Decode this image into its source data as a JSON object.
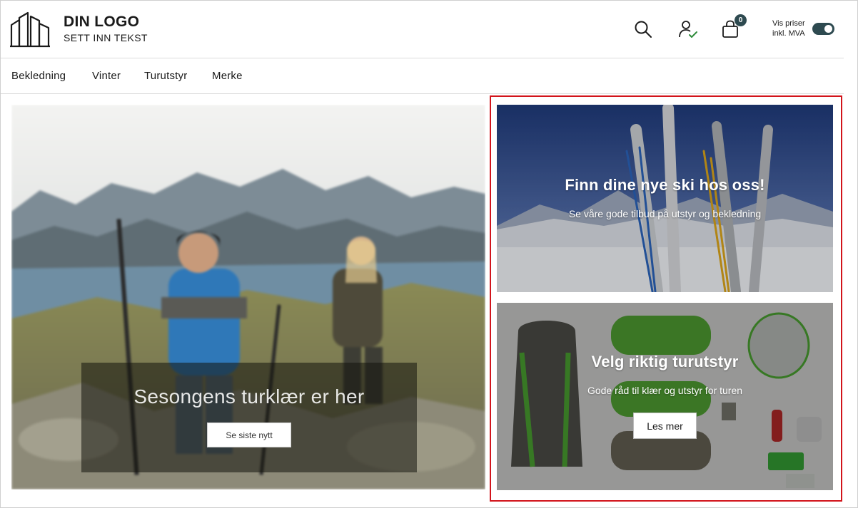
{
  "brand": {
    "title": "DIN LOGO",
    "subtitle": "SETT INN TEKST",
    "logo_icon": "buildings-outline-logo"
  },
  "header": {
    "icons": [
      "search-icon",
      "user-check-icon",
      "shopping-bag-icon"
    ],
    "cart_count": "0",
    "vat_line1": "Vis priser",
    "vat_line2": "inkl. MVA",
    "vat_toggle_on": true,
    "accent_color": "#2e4a50"
  },
  "nav": {
    "items": [
      {
        "label": "Bekledning"
      },
      {
        "label": "Vinter"
      },
      {
        "label": "Turutstyr"
      },
      {
        "label": "Merke"
      }
    ]
  },
  "hero": {
    "title": "Sesongens turklær er her",
    "button_label": "Se siste nytt"
  },
  "cards": [
    {
      "title": "Finn dine nye ski hos oss!",
      "subtitle": "Se våre gode tilbud på utstyr og bekledning"
    },
    {
      "title": "Velg riktig turutstyr",
      "subtitle": "Gode råd til klær og utstyr for turen",
      "button_label": "Les mer"
    }
  ],
  "highlight_color": "#d2141b"
}
